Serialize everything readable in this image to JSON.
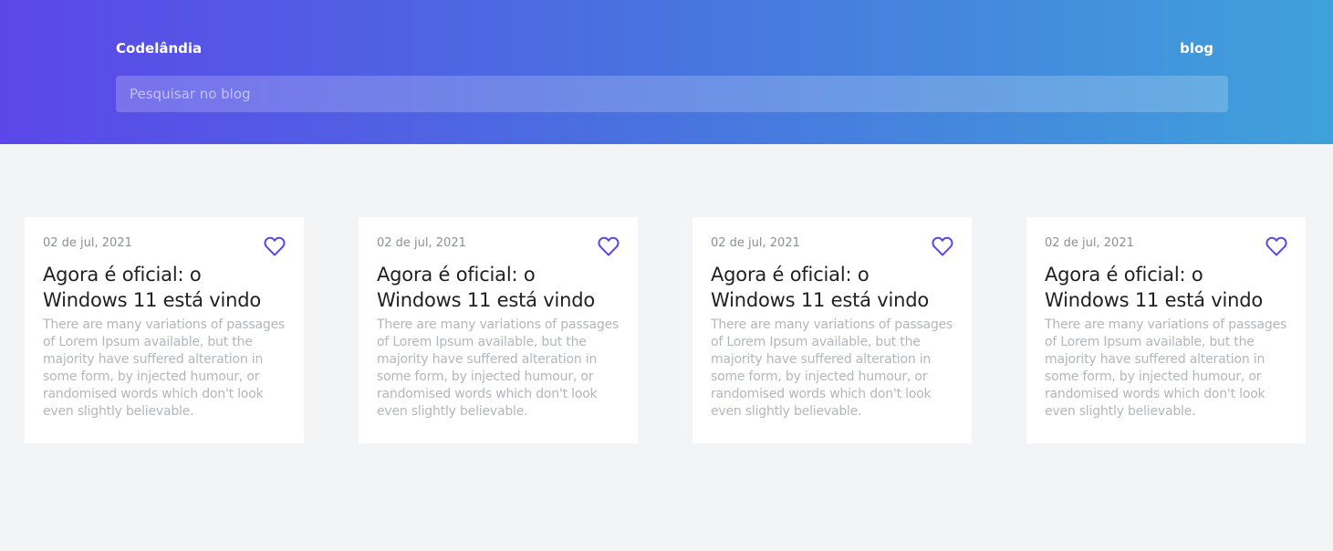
{
  "header": {
    "brand": "Codelândia",
    "nav_link": "blog",
    "search_placeholder": "Pesquisar no blog"
  },
  "colors": {
    "gradient_start": "#5b47e9",
    "gradient_end": "#3fa1da",
    "heart": "#5b47e9"
  },
  "posts": [
    {
      "date": "02 de jul, 2021",
      "title": "Agora é oficial: o Windows 11 está vindo",
      "excerpt": "There are many variations of passages of Lorem Ipsum available, but the majority have suffered alteration in some form, by injected humour, or randomised words which don't look even slightly believable.",
      "icon": "heart-icon"
    },
    {
      "date": "02 de jul, 2021",
      "title": "Agora é oficial: o Windows 11 está vindo",
      "excerpt": "There are many variations of passages of Lorem Ipsum available, but the majority have suffered alteration in some form, by injected humour, or randomised words which don't look even slightly believable.",
      "icon": "heart-icon"
    },
    {
      "date": "02 de jul, 2021",
      "title": "Agora é oficial: o Windows 11 está vindo",
      "excerpt": "There are many variations of passages of Lorem Ipsum available, but the majority have suffered alteration in some form, by injected humour, or randomised words which don't look even slightly believable.",
      "icon": "heart-icon"
    },
    {
      "date": "02 de jul, 2021",
      "title": "Agora é oficial: o Windows 11 está vindo",
      "excerpt": "There are many variations of passages of Lorem Ipsum available, but the majority have suffered alteration in some form, by injected humour, or randomised words which don't look even slightly believable.",
      "icon": "heart-icon"
    }
  ]
}
